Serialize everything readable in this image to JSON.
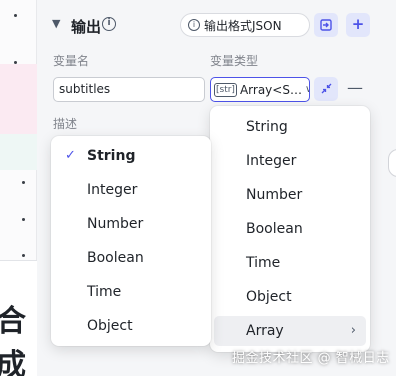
{
  "canvas": {
    "partial_text": "合成"
  },
  "output_panel": {
    "title": "输出",
    "info_icon": "info-icon",
    "format_button": "输出格式JSON",
    "col_name_label": "变量名",
    "col_type_label": "变量类型",
    "name_value": "subtitles",
    "type_value": "Array<S…",
    "type_icon_text": "[str]",
    "description_label": "描述",
    "accent_color": "#4d53e8"
  },
  "subtype_menu": {
    "items": [
      {
        "label": "String",
        "selected": true
      },
      {
        "label": "Integer",
        "selected": false
      },
      {
        "label": "Number",
        "selected": false
      },
      {
        "label": "Boolean",
        "selected": false
      },
      {
        "label": "Time",
        "selected": false
      },
      {
        "label": "Object",
        "selected": false
      }
    ]
  },
  "type_menu": {
    "items": [
      {
        "label": "String"
      },
      {
        "label": "Integer"
      },
      {
        "label": "Number"
      },
      {
        "label": "Boolean"
      },
      {
        "label": "Time"
      },
      {
        "label": "Object"
      },
      {
        "label": "Array",
        "has_submenu": true,
        "highlighted": true
      }
    ]
  },
  "watermark": "掘金技术社区 @ 智械日志"
}
